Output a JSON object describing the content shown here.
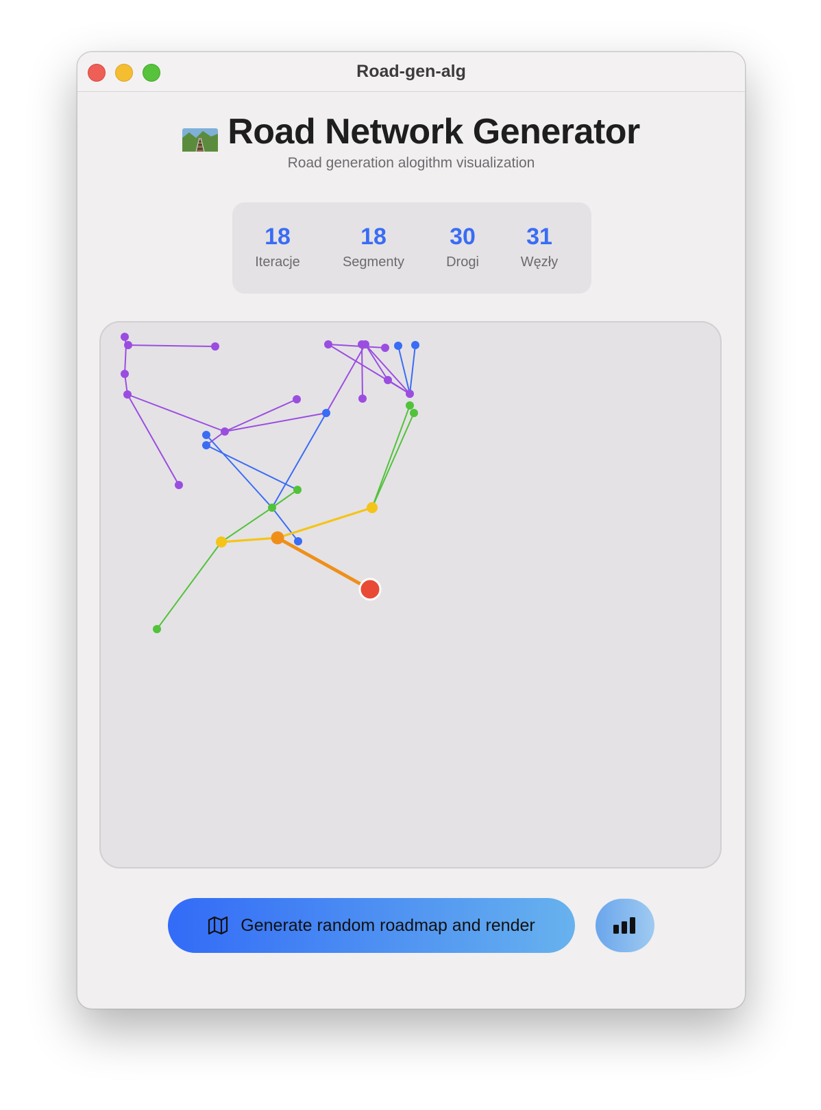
{
  "window": {
    "title": "Road-gen-alg"
  },
  "header": {
    "icon": "railway-track-icon",
    "title": "Road Network Generator",
    "subtitle": "Road generation alogithm visualization"
  },
  "stats": [
    {
      "value": "18",
      "label": "Iteracje"
    },
    {
      "value": "18",
      "label": "Segmenty"
    },
    {
      "value": "30",
      "label": "Drogi"
    },
    {
      "value": "31",
      "label": "Węzły"
    }
  ],
  "colors": {
    "purple": "#9b4de0",
    "blue": "#3a6cf4",
    "green": "#52c23a",
    "yellow": "#f4c418",
    "orange": "#ef8f1a",
    "red": "#e94a35",
    "accent": "#3a6cf4"
  },
  "buttons": {
    "generate_label": "Generate random roadmap and render",
    "generate_icon": "map-icon",
    "stats_icon": "bar-chart-icon"
  }
}
